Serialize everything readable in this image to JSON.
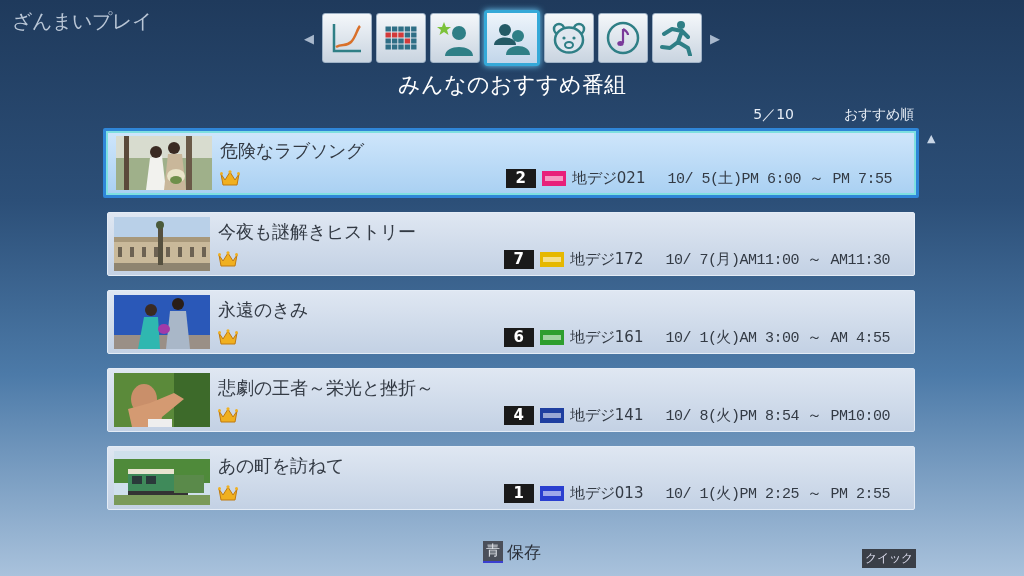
{
  "app_title": "ざんまいプレイ",
  "nav": {
    "prev": "◀",
    "next": "▶",
    "tabs": [
      {
        "kind": "chart",
        "selected": false
      },
      {
        "kind": "grid",
        "selected": false
      },
      {
        "kind": "star-person",
        "selected": false
      },
      {
        "kind": "people",
        "selected": true
      },
      {
        "kind": "bear",
        "selected": false
      },
      {
        "kind": "music",
        "selected": false
      },
      {
        "kind": "runner",
        "selected": false
      }
    ]
  },
  "heading": "みんなのおすすめ番組",
  "page_counter": "5／10",
  "sort_order": "おすすめ順",
  "scroll_up": "▲",
  "programs": [
    {
      "title": "危険なラブソング",
      "rank": "2",
      "channel": "地デジ021",
      "datetime": "10/ 5(土)PM 6:00 ～ PM 7:55",
      "color": "#e8207a",
      "selected": true
    },
    {
      "title": "今夜も謎解きヒストリー",
      "rank": "7",
      "channel": "地デジ172",
      "datetime": "10/ 7(月)AM11:00 ～ AM11:30",
      "color": "#e6b800",
      "selected": false
    },
    {
      "title": "永遠のきみ",
      "rank": "6",
      "channel": "地デジ161",
      "datetime": "10/ 1(火)AM 3:00 ～ AM 4:55",
      "color": "#2e9e2e",
      "selected": false
    },
    {
      "title": "悲劇の王者～栄光と挫折～",
      "rank": "4",
      "channel": "地デジ141",
      "datetime": "10/ 8(火)PM 8:54 ～ PM10:00",
      "color": "#1f3fa0",
      "selected": false
    },
    {
      "title": "あの町を訪ねて",
      "rank": "1",
      "channel": "地デジ013",
      "datetime": "10/ 1(火)PM 2:25 ～ PM 2:55",
      "color": "#2a3fd0",
      "selected": false
    }
  ],
  "footer": {
    "key": "青",
    "action": "保存",
    "quick": "クイック"
  }
}
